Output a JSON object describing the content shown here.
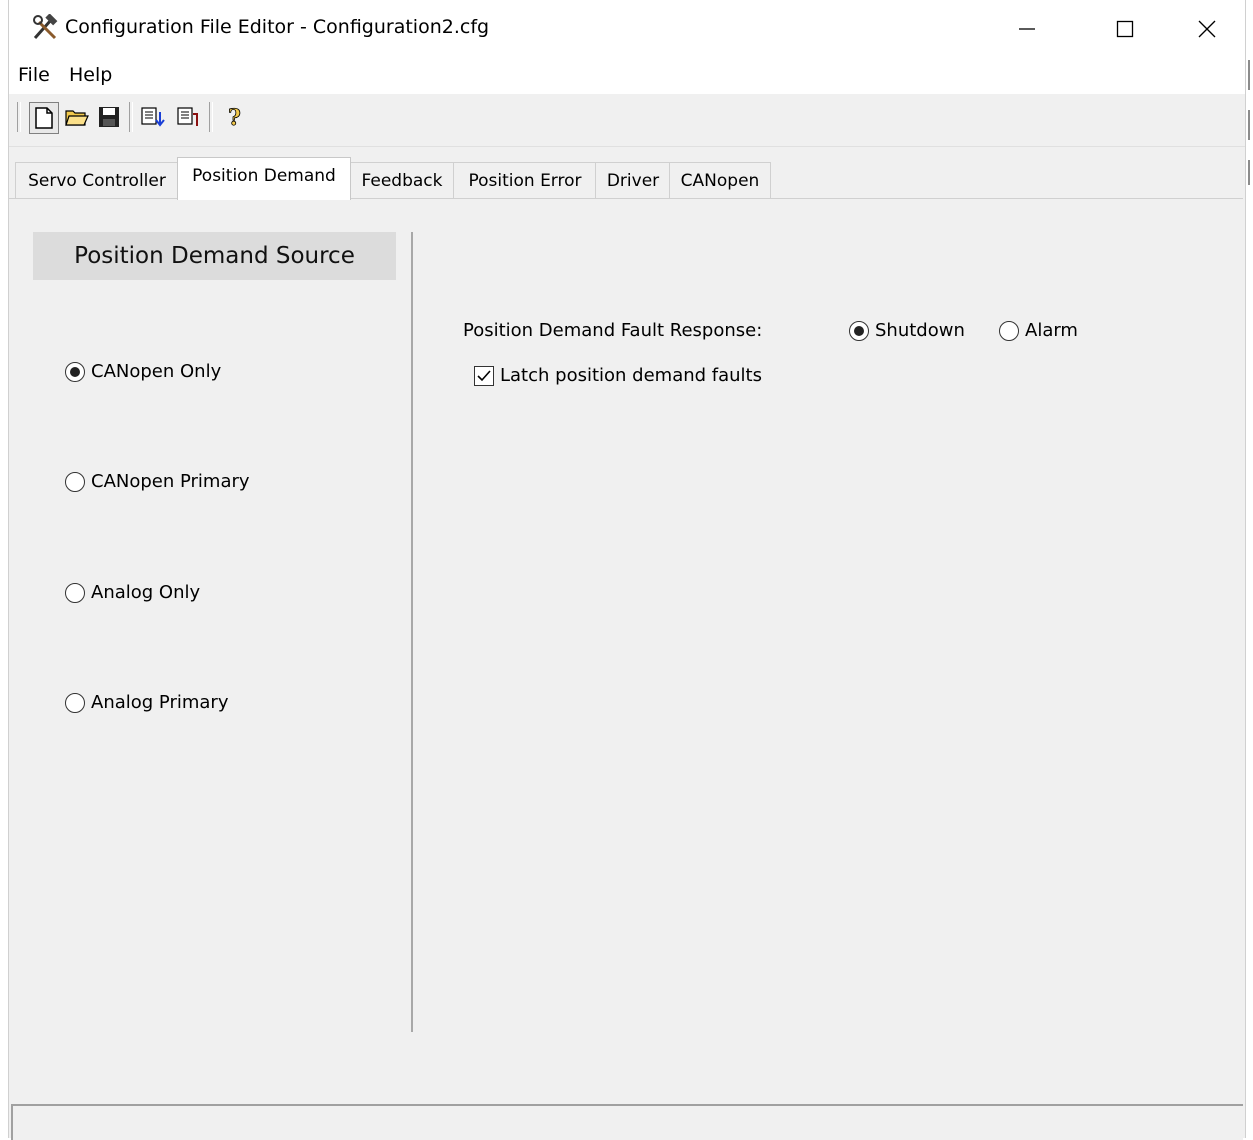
{
  "window": {
    "title": "Configuration File Editor - Configuration2.cfg",
    "app_icon": "tools-icon",
    "controls": {
      "minimize": "minimize-icon",
      "maximize": "maximize-icon",
      "close": "close-icon"
    }
  },
  "menu": {
    "file": "File",
    "help": "Help"
  },
  "toolbar": {
    "buttons": [
      "new-file-icon",
      "open-folder-icon",
      "save-icon",
      "download-config-icon",
      "upload-config-icon",
      "help-question-icon"
    ]
  },
  "tabs": [
    {
      "label": "Servo Controller",
      "active": false
    },
    {
      "label": "Position Demand",
      "active": true
    },
    {
      "label": "Feedback",
      "active": false
    },
    {
      "label": "Position Error",
      "active": false
    },
    {
      "label": "Driver",
      "active": false
    },
    {
      "label": "CANopen",
      "active": false
    }
  ],
  "source": {
    "header": "Position Demand Source",
    "options": [
      {
        "label": "CANopen Only",
        "selected": true
      },
      {
        "label": "CANopen Primary",
        "selected": false
      },
      {
        "label": "Analog Only",
        "selected": false
      },
      {
        "label": "Analog Primary",
        "selected": false
      }
    ]
  },
  "fault": {
    "label": "Position Demand Fault Response:",
    "shutdown_label": "Shutdown",
    "shutdown_selected": true,
    "alarm_label": "Alarm",
    "alarm_selected": false,
    "latch_label": "Latch position demand faults",
    "latch_checked": true
  },
  "statusbar": {
    "text": ""
  }
}
